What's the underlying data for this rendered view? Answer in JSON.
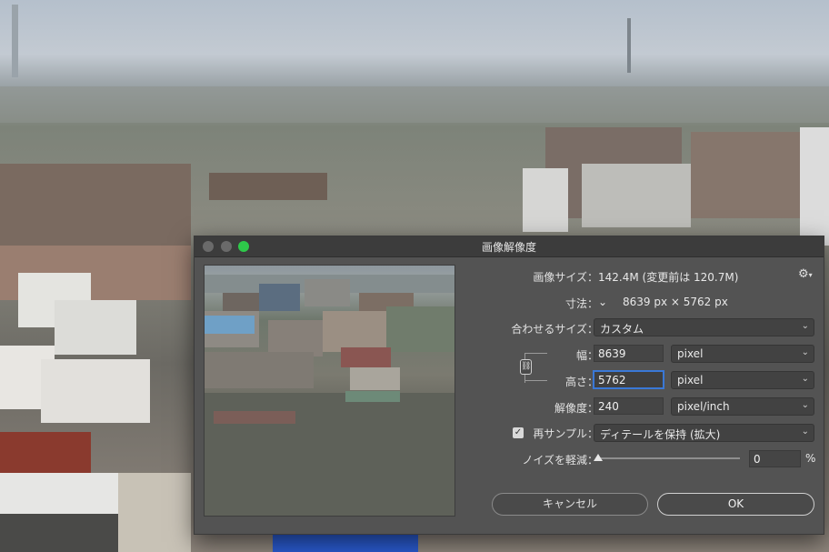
{
  "dialog": {
    "title": "画像解像度",
    "image_size_label": "画像サイズ：",
    "image_size_value": "142.4M (変更前は 120.7M)",
    "dimensions_label": "寸法：",
    "dimensions_value": "8639 px × 5762 px",
    "fit_label": "合わせるサイズ：",
    "fit_value": "カスタム",
    "width_label": "幅：",
    "width_value": "8639",
    "width_unit": "pixel",
    "height_label": "高さ：",
    "height_value": "5762",
    "height_unit": "pixel",
    "resolution_label": "解像度：",
    "resolution_value": "240",
    "resolution_unit": "pixel/inch",
    "resample_label": "再サンプル：",
    "resample_checked": true,
    "resample_value": "ディテールを保持 (拡大)",
    "noise_label": "ノイズを軽減：",
    "noise_value": "0",
    "noise_unit": "%",
    "cancel_label": "キャンセル",
    "ok_label": "OK"
  },
  "icons": {
    "settings": "gear-icon",
    "constrain": "link-icon",
    "checkbox": "checkmark-icon",
    "dropdown": "chevron-down-icon"
  }
}
